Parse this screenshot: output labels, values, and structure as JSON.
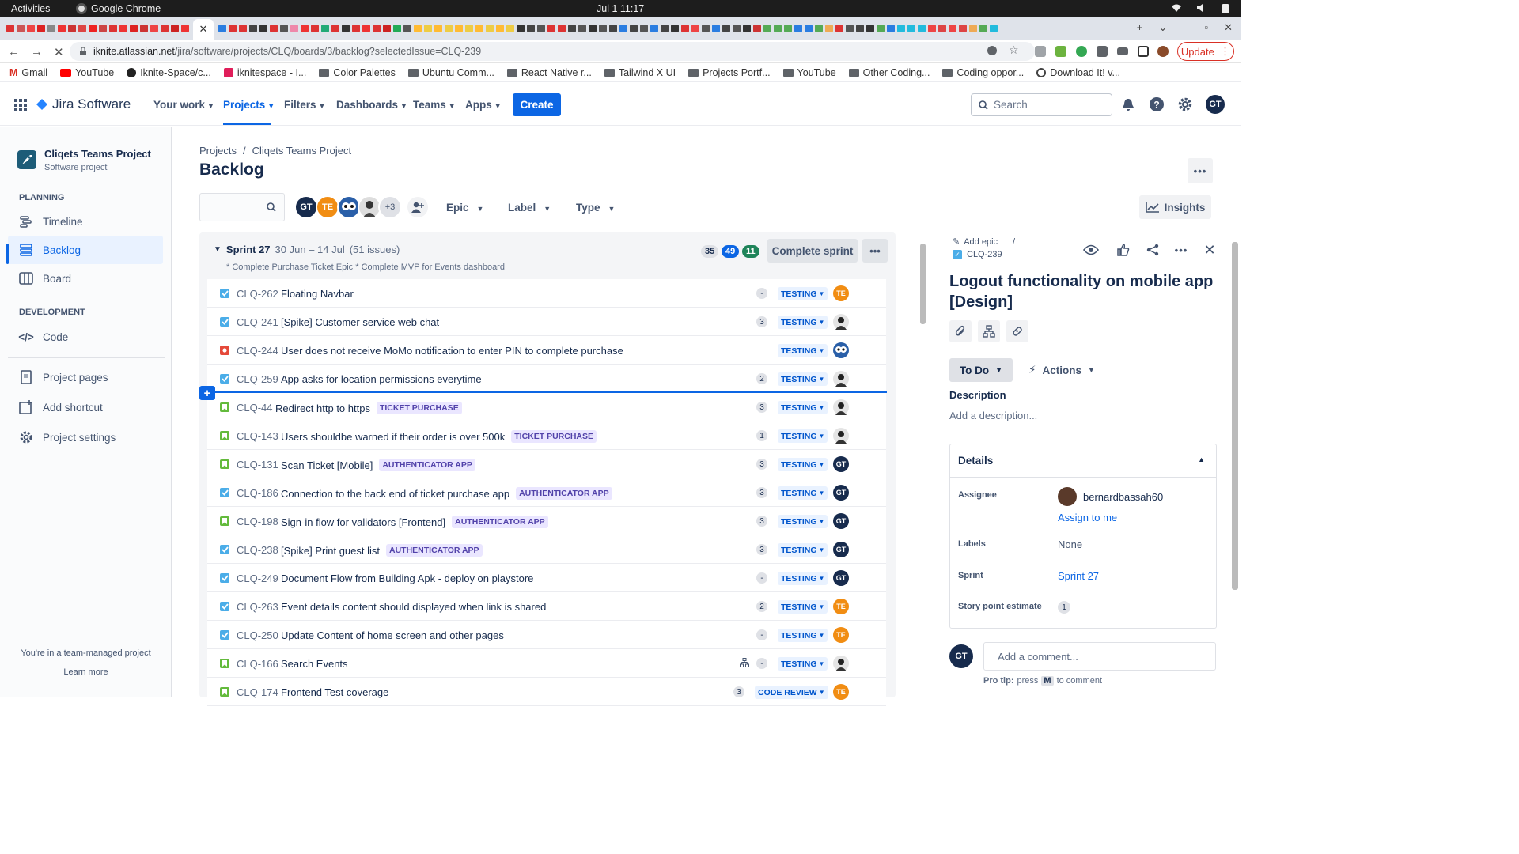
{
  "os": {
    "activities": "Activities",
    "app": "Google Chrome",
    "clock": "Jul 1  11:17"
  },
  "browser": {
    "url_domain": "iknite.atlassian.net",
    "url_path": "/jira/software/projects/CLQ/boards/3/backlog?selectedIssue=CLQ-239",
    "update_label": "Update",
    "bookmarks": [
      "Gmail",
      "YouTube",
      "Iknite-Space/c...",
      "iknitespace - I...",
      "Color Palettes",
      "Ubuntu Comm...",
      "React Native r...",
      "Tailwind X UI",
      "Projects Portf...",
      "YouTube",
      "Other Coding...",
      "Coding oppor...",
      "Download It! v..."
    ]
  },
  "header": {
    "product": "Jira Software",
    "nav": [
      "Your work",
      "Projects",
      "Filters",
      "Dashboards",
      "Teams",
      "Apps"
    ],
    "create": "Create",
    "search_placeholder": "Search",
    "user_initials": "GT"
  },
  "sidebar": {
    "project_name": "Cliqets Teams Project",
    "project_type": "Software project",
    "planning_label": "PLANNING",
    "development_label": "DEVELOPMENT",
    "items": [
      "Timeline",
      "Backlog",
      "Board",
      "Code",
      "Project pages",
      "Add shortcut",
      "Project settings"
    ],
    "team_note": "You're in a team-managed project",
    "learn_more": "Learn more"
  },
  "main": {
    "breadcrumb": [
      "Projects",
      "Cliqets Teams Project"
    ],
    "title": "Backlog",
    "avatars": [
      "GT",
      "TE"
    ],
    "more_avatars": "+3",
    "filters": [
      "Epic",
      "Label",
      "Type"
    ],
    "insights": "Insights"
  },
  "sprint": {
    "name": "Sprint 27",
    "dates": "30 Jun – 14 Jul",
    "count": "(51 issues)",
    "goal": "* Complete Purchase Ticket Epic * Complete MVP for Events dashboard",
    "todo": "35",
    "in_progress": "49",
    "done": "11",
    "complete_label": "Complete sprint",
    "issues": [
      {
        "key": "CLQ-262",
        "summary": "Floating Navbar",
        "epic": "",
        "est": "-",
        "status": "TESTING",
        "type": "task",
        "assignee": "TE"
      },
      {
        "key": "CLQ-241",
        "summary": "[Spike] Customer service web chat",
        "epic": "",
        "est": "3",
        "status": "TESTING",
        "type": "task",
        "assignee": "photo"
      },
      {
        "key": "CLQ-244",
        "summary": "User does not receive MoMo notification to enter PIN to complete purchase",
        "epic": "",
        "est": "",
        "status": "TESTING",
        "type": "bug",
        "assignee": "owl"
      },
      {
        "key": "CLQ-259",
        "summary": "App asks for location permissions everytime",
        "epic": "",
        "est": "2",
        "status": "TESTING",
        "type": "task",
        "assignee": "photo"
      },
      {
        "key": "CLQ-44",
        "summary": "Redirect http to https",
        "epic": "TICKET PURCHASE",
        "est": "3",
        "status": "TESTING",
        "type": "story",
        "assignee": "photo"
      },
      {
        "key": "CLQ-143",
        "summary": "Users shouldbe warned if their order is over 500k",
        "epic": "TICKET PURCHASE",
        "est": "1",
        "status": "TESTING",
        "type": "story",
        "assignee": "photo"
      },
      {
        "key": "CLQ-131",
        "summary": "Scan Ticket [Mobile]",
        "epic": "AUTHENTICATOR APP",
        "est": "3",
        "status": "TESTING",
        "type": "story",
        "assignee": "GT"
      },
      {
        "key": "CLQ-186",
        "summary": "Connection to the back end of ticket purchase app",
        "epic": "AUTHENTICATOR APP",
        "est": "3",
        "status": "TESTING",
        "type": "task",
        "assignee": "GT"
      },
      {
        "key": "CLQ-198",
        "summary": "Sign-in flow for validators [Frontend]",
        "epic": "AUTHENTICATOR APP",
        "est": "3",
        "status": "TESTING",
        "type": "story",
        "assignee": "GT"
      },
      {
        "key": "CLQ-238",
        "summary": "[Spike] Print guest list",
        "epic": "AUTHENTICATOR APP",
        "est": "3",
        "status": "TESTING",
        "type": "task",
        "assignee": "GT"
      },
      {
        "key": "CLQ-249",
        "summary": "Document Flow from Building Apk - deploy on playstore",
        "epic": "",
        "est": "-",
        "status": "TESTING",
        "type": "task",
        "assignee": "GT"
      },
      {
        "key": "CLQ-263",
        "summary": "Event details content should displayed when link is shared",
        "epic": "",
        "est": "2",
        "status": "TESTING",
        "type": "task",
        "assignee": "TE"
      },
      {
        "key": "CLQ-250",
        "summary": "Update Content of home screen and other pages",
        "epic": "",
        "est": "-",
        "status": "TESTING",
        "type": "task",
        "assignee": "TE"
      },
      {
        "key": "CLQ-166",
        "summary": "Search Events",
        "epic": "",
        "est": "-",
        "status": "TESTING",
        "type": "story",
        "assignee": "photo",
        "child": true
      },
      {
        "key": "CLQ-174",
        "summary": "Frontend Test coverage",
        "epic": "",
        "est": "3",
        "status": "CODE REVIEW",
        "type": "story",
        "assignee": "TE"
      }
    ]
  },
  "detail": {
    "add_epic": "Add epic",
    "key": "CLQ-239",
    "title": "Logout functionality on mobile app [Design]",
    "status": "To Do",
    "actions": "Actions",
    "description_label": "Description",
    "description_placeholder": "Add a description...",
    "details_label": "Details",
    "assignee_label": "Assignee",
    "assignee": "bernardbassah60",
    "assign_to_me": "Assign to me",
    "labels_label": "Labels",
    "labels": "None",
    "sprint_label": "Sprint",
    "sprint": "Sprint 27",
    "sp_label": "Story point estimate",
    "sp": "1",
    "comment_placeholder": "Add a comment...",
    "protip_a": "Pro tip:",
    "protip_b": "press",
    "protip_key": "M",
    "protip_c": "to comment",
    "user_initials": "GT"
  },
  "colors": {
    "primary": "#0c66e4",
    "avatar_te": "#f18d13",
    "avatar_gt": "#172b4d",
    "epic_bg": "#eae6ff",
    "epic_fg": "#5243aa",
    "status_bg": "#e9f2ff",
    "task": "#4bade8",
    "bug": "#e5493a",
    "story": "#63ba3c"
  }
}
